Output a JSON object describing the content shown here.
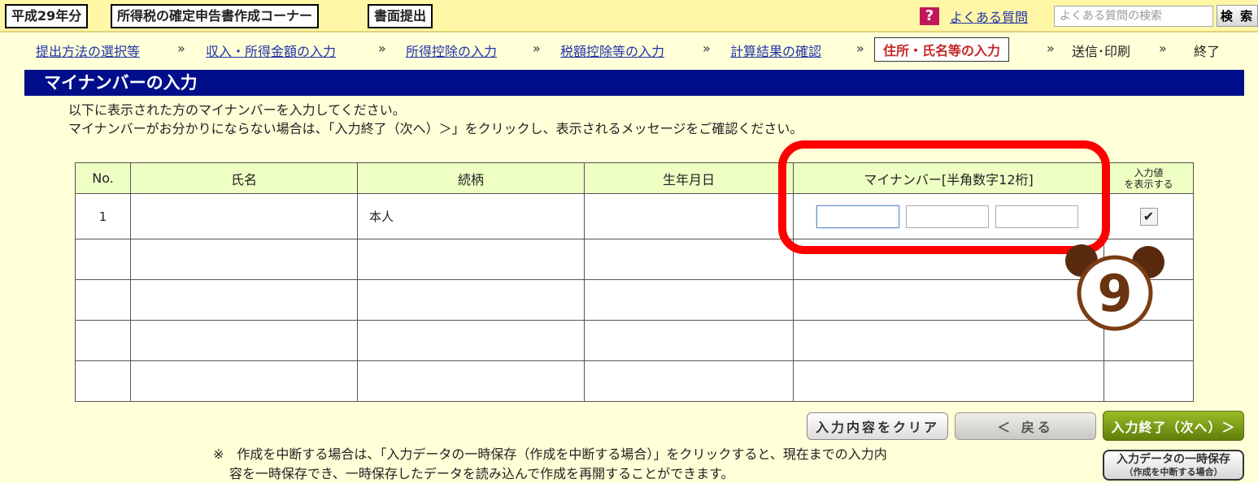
{
  "header": {
    "year_tag": "平成29年分",
    "corner_tag": "所得税の確定申告書作成コーナー",
    "submit_tag": "書面提出",
    "help_icon": "?",
    "help_link": "よくある質問",
    "search_placeholder": "よくある質問の検索",
    "search_button": "検 索"
  },
  "steps": [
    "提出方法の選択等",
    "収入・所得金額の入力",
    "所得控除の入力",
    "税額控除等の入力",
    "計算結果の確認",
    "住所・氏名等の入力",
    "送信･印刷",
    "終了"
  ],
  "step_separator": "»",
  "page_title": "マイナンバーの入力",
  "instructions": [
    "以下に表示された方のマイナンバーを入力してください。",
    "マイナンバーがお分かりにならない場合は、「入力終了（次へ）＞」をクリックし、表示されるメッセージをご確認ください。"
  ],
  "table": {
    "headers": {
      "no": "No.",
      "name": "氏名",
      "relation": "続柄",
      "birthdate": "生年月日",
      "mynumber": "マイナンバー[半角数字12桁]",
      "show_line1": "入力値",
      "show_line2": "を表示する"
    },
    "rows": [
      {
        "no": "1",
        "name": "",
        "relation": "本人",
        "birthdate": "",
        "checked": "✔"
      }
    ]
  },
  "overlay": {
    "circle_number": "9"
  },
  "buttons": {
    "clear": "入力内容をクリア",
    "back": "＜ 戻る",
    "next": "入力終了（次へ）＞",
    "save_line1": "入力データの一時保存",
    "save_line2": "（作成を中断する場合）"
  },
  "footnote": {
    "line1": "※　作成を中断する場合は、「入力データの一時保存（作成を中断する場合）」をクリックすると、現在までの入力内",
    "line2": "容を一時保存でき、一時保存したデータを読み込んで作成を再開することができます。"
  },
  "colors": {
    "title_bar": "#000e8a",
    "highlight": "#ff0000",
    "next_button": "#7a9a18",
    "header_cell": "#eeffc4"
  }
}
